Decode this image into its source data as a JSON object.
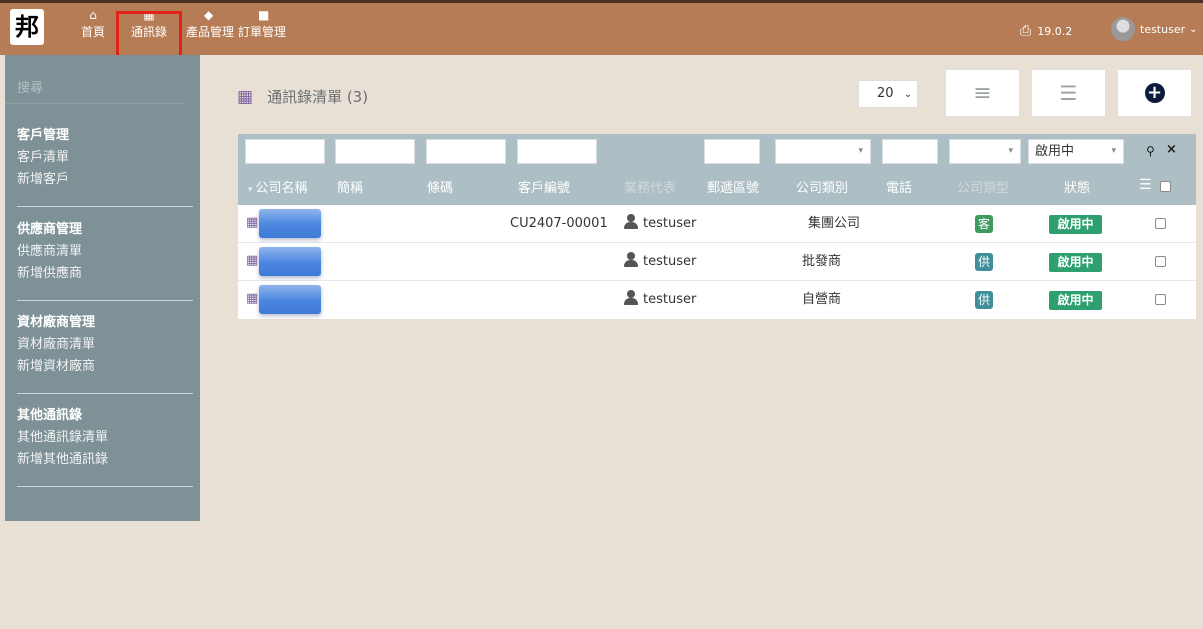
{
  "topbar": {
    "logo": "邦",
    "nav": [
      {
        "label": "首頁",
        "icon": "home-icon",
        "glyph": "⌂"
      },
      {
        "label": "通訊錄",
        "icon": "building-icon",
        "glyph": "▦"
      },
      {
        "label": "產品管理",
        "icon": "cube-icon",
        "glyph": "◆"
      },
      {
        "label": "訂單管理",
        "icon": "briefcase-icon",
        "glyph": "■"
      }
    ],
    "version": "19.0.2",
    "username": "testuser"
  },
  "sidebar": {
    "search_placeholder": "搜尋",
    "sections": [
      {
        "title": "客戶管理",
        "links": [
          "客戶清單",
          "新增客戶"
        ]
      },
      {
        "title": "供應商管理",
        "links": [
          "供應商清單",
          "新增供應商"
        ]
      },
      {
        "title": "資材廠商管理",
        "links": [
          "資材廠商清單",
          "新增資材廠商"
        ]
      },
      {
        "title": "其他通訊錄",
        "links": [
          "其他通訊錄清單",
          "新增其他通訊錄"
        ]
      }
    ]
  },
  "main": {
    "title": "通訊錄清單 (3)",
    "page_size": "20",
    "filters": {
      "status_value": "啟用中"
    },
    "columns": [
      "公司名稱",
      "簡稱",
      "條碼",
      "客戶編號",
      "業務代表",
      "郵遞區號",
      "公司類別",
      "電話",
      "公司類型",
      "狀態"
    ],
    "rows": [
      {
        "code": "CU2407-00001",
        "rep": "testuser",
        "category": "集團公司",
        "type": "客",
        "type_color": "#3f9a60",
        "status": "啟用中"
      },
      {
        "code": "",
        "rep": "testuser",
        "category": "批發商",
        "type": "供",
        "type_color": "#3f8f9a",
        "status": "啟用中"
      },
      {
        "code": "",
        "rep": "testuser",
        "category": "自營商",
        "type": "供",
        "type_color": "#3f8f9a",
        "status": "啟用中"
      }
    ]
  },
  "colors": {
    "topbar": "#b57c55",
    "sidebar": "#7d9197",
    "status_badge": "#2e9f6e",
    "highlight": "#e2231a"
  }
}
